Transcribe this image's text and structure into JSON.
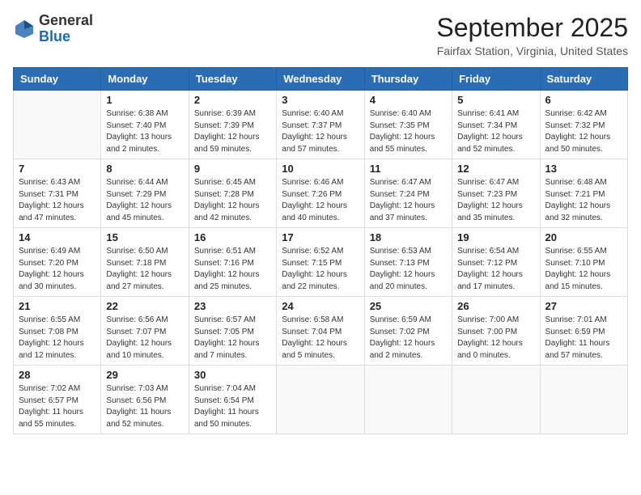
{
  "header": {
    "logo_general": "General",
    "logo_blue": "Blue",
    "month": "September 2025",
    "location": "Fairfax Station, Virginia, United States"
  },
  "weekdays": [
    "Sunday",
    "Monday",
    "Tuesday",
    "Wednesday",
    "Thursday",
    "Friday",
    "Saturday"
  ],
  "weeks": [
    [
      {
        "day": "",
        "info": ""
      },
      {
        "day": "1",
        "info": "Sunrise: 6:38 AM\nSunset: 7:40 PM\nDaylight: 13 hours\nand 2 minutes."
      },
      {
        "day": "2",
        "info": "Sunrise: 6:39 AM\nSunset: 7:39 PM\nDaylight: 12 hours\nand 59 minutes."
      },
      {
        "day": "3",
        "info": "Sunrise: 6:40 AM\nSunset: 7:37 PM\nDaylight: 12 hours\nand 57 minutes."
      },
      {
        "day": "4",
        "info": "Sunrise: 6:40 AM\nSunset: 7:35 PM\nDaylight: 12 hours\nand 55 minutes."
      },
      {
        "day": "5",
        "info": "Sunrise: 6:41 AM\nSunset: 7:34 PM\nDaylight: 12 hours\nand 52 minutes."
      },
      {
        "day": "6",
        "info": "Sunrise: 6:42 AM\nSunset: 7:32 PM\nDaylight: 12 hours\nand 50 minutes."
      }
    ],
    [
      {
        "day": "7",
        "info": "Sunrise: 6:43 AM\nSunset: 7:31 PM\nDaylight: 12 hours\nand 47 minutes."
      },
      {
        "day": "8",
        "info": "Sunrise: 6:44 AM\nSunset: 7:29 PM\nDaylight: 12 hours\nand 45 minutes."
      },
      {
        "day": "9",
        "info": "Sunrise: 6:45 AM\nSunset: 7:28 PM\nDaylight: 12 hours\nand 42 minutes."
      },
      {
        "day": "10",
        "info": "Sunrise: 6:46 AM\nSunset: 7:26 PM\nDaylight: 12 hours\nand 40 minutes."
      },
      {
        "day": "11",
        "info": "Sunrise: 6:47 AM\nSunset: 7:24 PM\nDaylight: 12 hours\nand 37 minutes."
      },
      {
        "day": "12",
        "info": "Sunrise: 6:47 AM\nSunset: 7:23 PM\nDaylight: 12 hours\nand 35 minutes."
      },
      {
        "day": "13",
        "info": "Sunrise: 6:48 AM\nSunset: 7:21 PM\nDaylight: 12 hours\nand 32 minutes."
      }
    ],
    [
      {
        "day": "14",
        "info": "Sunrise: 6:49 AM\nSunset: 7:20 PM\nDaylight: 12 hours\nand 30 minutes."
      },
      {
        "day": "15",
        "info": "Sunrise: 6:50 AM\nSunset: 7:18 PM\nDaylight: 12 hours\nand 27 minutes."
      },
      {
        "day": "16",
        "info": "Sunrise: 6:51 AM\nSunset: 7:16 PM\nDaylight: 12 hours\nand 25 minutes."
      },
      {
        "day": "17",
        "info": "Sunrise: 6:52 AM\nSunset: 7:15 PM\nDaylight: 12 hours\nand 22 minutes."
      },
      {
        "day": "18",
        "info": "Sunrise: 6:53 AM\nSunset: 7:13 PM\nDaylight: 12 hours\nand 20 minutes."
      },
      {
        "day": "19",
        "info": "Sunrise: 6:54 AM\nSunset: 7:12 PM\nDaylight: 12 hours\nand 17 minutes."
      },
      {
        "day": "20",
        "info": "Sunrise: 6:55 AM\nSunset: 7:10 PM\nDaylight: 12 hours\nand 15 minutes."
      }
    ],
    [
      {
        "day": "21",
        "info": "Sunrise: 6:55 AM\nSunset: 7:08 PM\nDaylight: 12 hours\nand 12 minutes."
      },
      {
        "day": "22",
        "info": "Sunrise: 6:56 AM\nSunset: 7:07 PM\nDaylight: 12 hours\nand 10 minutes."
      },
      {
        "day": "23",
        "info": "Sunrise: 6:57 AM\nSunset: 7:05 PM\nDaylight: 12 hours\nand 7 minutes."
      },
      {
        "day": "24",
        "info": "Sunrise: 6:58 AM\nSunset: 7:04 PM\nDaylight: 12 hours\nand 5 minutes."
      },
      {
        "day": "25",
        "info": "Sunrise: 6:59 AM\nSunset: 7:02 PM\nDaylight: 12 hours\nand 2 minutes."
      },
      {
        "day": "26",
        "info": "Sunrise: 7:00 AM\nSunset: 7:00 PM\nDaylight: 12 hours\nand 0 minutes."
      },
      {
        "day": "27",
        "info": "Sunrise: 7:01 AM\nSunset: 6:59 PM\nDaylight: 11 hours\nand 57 minutes."
      }
    ],
    [
      {
        "day": "28",
        "info": "Sunrise: 7:02 AM\nSunset: 6:57 PM\nDaylight: 11 hours\nand 55 minutes."
      },
      {
        "day": "29",
        "info": "Sunrise: 7:03 AM\nSunset: 6:56 PM\nDaylight: 11 hours\nand 52 minutes."
      },
      {
        "day": "30",
        "info": "Sunrise: 7:04 AM\nSunset: 6:54 PM\nDaylight: 11 hours\nand 50 minutes."
      },
      {
        "day": "",
        "info": ""
      },
      {
        "day": "",
        "info": ""
      },
      {
        "day": "",
        "info": ""
      },
      {
        "day": "",
        "info": ""
      }
    ]
  ]
}
